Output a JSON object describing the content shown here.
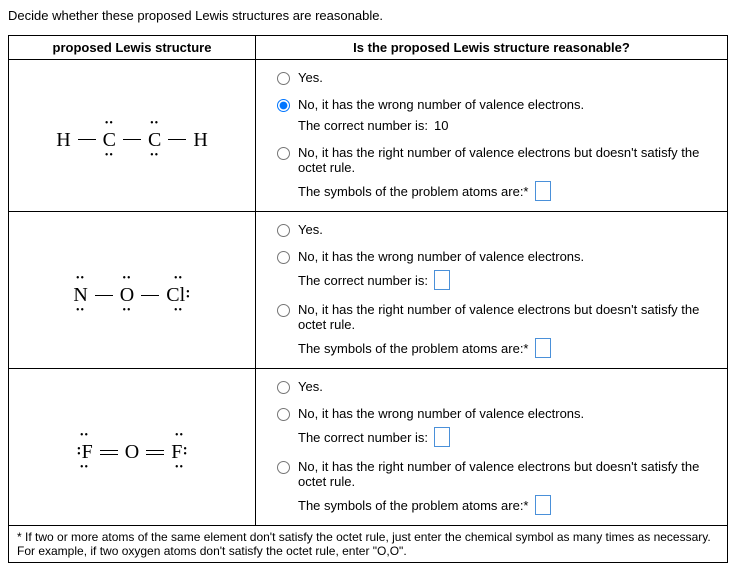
{
  "question": "Decide whether these proposed Lewis structures are reasonable.",
  "headers": {
    "structure": "proposed Lewis structure",
    "reasonable": "Is the proposed Lewis structure reasonable?"
  },
  "options": {
    "yes": "Yes.",
    "wrong_valence": "No, it has the wrong number of valence electrons.",
    "correct_number_label": "The correct number is:",
    "octet": "No, it has the right number of valence electrons but doesn't satisfy the octet rule.",
    "symbols_label": "The symbols of the problem atoms are:*"
  },
  "rows": [
    {
      "structure_id": "hcch",
      "selected": "wrong_valence",
      "correct_number": "10",
      "symbols": ""
    },
    {
      "structure_id": "nocl",
      "selected": "",
      "correct_number": "",
      "symbols": ""
    },
    {
      "structure_id": "fof",
      "selected": "",
      "correct_number": "",
      "symbols": ""
    }
  ],
  "footnote": "* If two or more atoms of the same element don't satisfy the octet rule, just enter the chemical symbol as many times as necessary. For example, if two oxygen atoms don't satisfy the octet rule, enter \"O,O\"."
}
